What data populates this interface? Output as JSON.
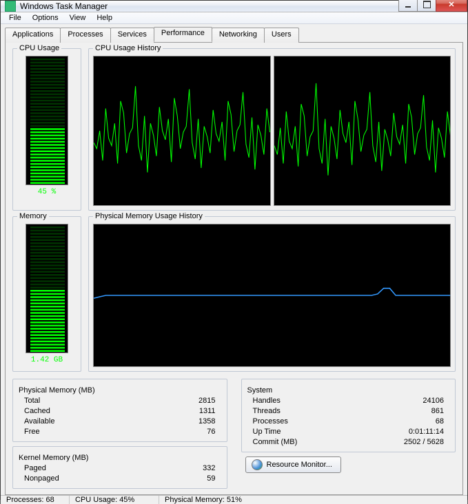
{
  "window": {
    "title": "Windows Task Manager"
  },
  "menus": {
    "file": "File",
    "options": "Options",
    "view": "View",
    "help": "Help"
  },
  "tabs": {
    "applications": "Applications",
    "processes": "Processes",
    "services": "Services",
    "performance": "Performance",
    "networking": "Networking",
    "users": "Users"
  },
  "groups": {
    "cpu_usage": "CPU Usage",
    "cpu_history": "CPU Usage History",
    "memory": "Memory",
    "mem_history": "Physical Memory Usage History"
  },
  "meters": {
    "cpu_label": "45 %",
    "cpu_pct": 45,
    "mem_label": "1.42 GB",
    "mem_pct": 50
  },
  "phys_mem": {
    "title": "Physical Memory (MB)",
    "total_l": "Total",
    "total_v": "2815",
    "cached_l": "Cached",
    "cached_v": "1311",
    "avail_l": "Available",
    "avail_v": "1358",
    "free_l": "Free",
    "free_v": "76"
  },
  "kernel_mem": {
    "title": "Kernel Memory (MB)",
    "paged_l": "Paged",
    "paged_v": "332",
    "nonpaged_l": "Nonpaged",
    "nonpaged_v": "59"
  },
  "system": {
    "title": "System",
    "handles_l": "Handles",
    "handles_v": "24106",
    "threads_l": "Threads",
    "threads_v": "861",
    "procs_l": "Processes",
    "procs_v": "68",
    "uptime_l": "Up Time",
    "uptime_v": "0:01:11:14",
    "commit_l": "Commit (MB)",
    "commit_v": "2502 / 5628"
  },
  "resmon_btn": "Resource Monitor...",
  "statusbar": {
    "procs": "Processes: 68",
    "cpu": "CPU Usage: 45%",
    "mem": "Physical Memory: 51%"
  },
  "chart_data": [
    {
      "type": "line",
      "title": "CPU Usage History (core 1)",
      "ylim": [
        0,
        100
      ],
      "ylabel": "%",
      "values": [
        42,
        38,
        50,
        30,
        65,
        45,
        40,
        55,
        28,
        70,
        62,
        35,
        48,
        52,
        80,
        40,
        30,
        60,
        22,
        55,
        47,
        33,
        66,
        50,
        44,
        58,
        29,
        72,
        60,
        38,
        49,
        53,
        78,
        42,
        31,
        58,
        25,
        53,
        46,
        35,
        64,
        48,
        43,
        56,
        30,
        70,
        61,
        36,
        50,
        54,
        76,
        41,
        32,
        59,
        24,
        54,
        47,
        34,
        65,
        49
      ]
    },
    {
      "type": "line",
      "title": "CPU Usage History (core 2)",
      "ylim": [
        0,
        100
      ],
      "ylabel": "%",
      "values": [
        40,
        34,
        52,
        28,
        63,
        43,
        38,
        53,
        26,
        68,
        60,
        33,
        46,
        50,
        82,
        38,
        28,
        58,
        20,
        53,
        45,
        31,
        64,
        48,
        42,
        56,
        27,
        70,
        58,
        36,
        47,
        51,
        76,
        40,
        29,
        56,
        23,
        51,
        44,
        33,
        62,
        46,
        41,
        54,
        28,
        68,
        59,
        34,
        48,
        52,
        74,
        39,
        30,
        57,
        22,
        52,
        45,
        32,
        63,
        47
      ]
    },
    {
      "type": "line",
      "title": "Physical Memory Usage History",
      "ylim": [
        0,
        100
      ],
      "ylabel": "%",
      "values": [
        48,
        49,
        50,
        50,
        50,
        50,
        50,
        50,
        50,
        50,
        50,
        50,
        50,
        50,
        50,
        50,
        50,
        50,
        50,
        50,
        50,
        50,
        50,
        50,
        50,
        50,
        50,
        50,
        50,
        50,
        50,
        50,
        50,
        50,
        50,
        50,
        50,
        50,
        50,
        50,
        50,
        50,
        50,
        50,
        50,
        50,
        50,
        51,
        55,
        55,
        50,
        50,
        50,
        50,
        50,
        50,
        50,
        50,
        50,
        50
      ]
    }
  ]
}
